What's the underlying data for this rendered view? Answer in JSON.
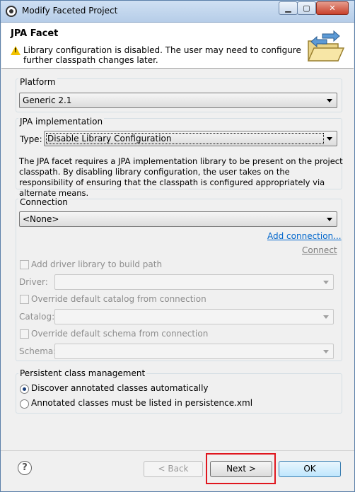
{
  "window": {
    "title": "Modify Faceted Project"
  },
  "header": {
    "title": "JPA Facet",
    "message": "Library configuration is disabled. The user may need to configure further classpath changes later."
  },
  "platform": {
    "label": "Platform",
    "value": "Generic 2.1"
  },
  "jpa_implementation": {
    "label": "JPA implementation",
    "type_label": "Type:",
    "type_value": "Disable Library Configuration",
    "description": "The JPA facet requires a JPA implementation library to be present on the project classpath. By disabling library configuration, the user takes on the responsibility of ensuring that the classpath is configured appropriately via alternate means."
  },
  "connection": {
    "label": "Connection",
    "value": "<None>",
    "add_link": "Add connection...",
    "connect_link": "Connect",
    "add_driver_label": "Add driver library to build path",
    "driver_label": "Driver:",
    "override_catalog_label": "Override default catalog from connection",
    "catalog_label": "Catalog:",
    "override_schema_label": "Override default schema from connection",
    "schema_label": "Schema:"
  },
  "persistent": {
    "label": "Persistent class management",
    "option1": "Discover annotated classes automatically",
    "option2": "Annotated classes must be listed in persistence.xml",
    "selected": "option1"
  },
  "buttons": {
    "back": "< Back",
    "next": "Next >",
    "ok": "OK"
  },
  "icons": {
    "help": "?"
  }
}
